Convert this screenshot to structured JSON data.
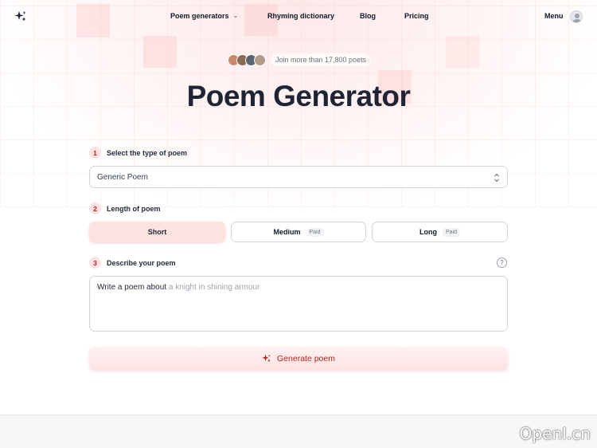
{
  "header": {
    "logo_icon": "sparkles-icon",
    "nav": [
      {
        "label": "Poem generators",
        "has_dropdown": true
      },
      {
        "label": "Rhyming dictionary"
      },
      {
        "label": "Blog"
      },
      {
        "label": "Pricing"
      }
    ],
    "menu_label": "Menu",
    "user_icon": "user-avatar-icon"
  },
  "social_proof": {
    "text": "Join more than 17,800 poets",
    "avatar_count": 4
  },
  "title": "Poem Generator",
  "steps": [
    {
      "number": "1",
      "label": "Select the type of poem"
    },
    {
      "number": "2",
      "label": "Length of poem"
    },
    {
      "number": "3",
      "label": "Describe your poem"
    }
  ],
  "poem_type": {
    "selected": "Generic Poem"
  },
  "lengths": [
    {
      "label": "Short",
      "selected": true
    },
    {
      "label": "Medium",
      "badge": "Paid"
    },
    {
      "label": "Long",
      "badge": "Paid"
    }
  ],
  "description": {
    "prefix": "Write a poem about",
    "placeholder": "a knight in shining armour"
  },
  "generate_button": {
    "label": "Generate poem",
    "icon": "sparkles-icon"
  },
  "watermark": "OpenI.cn",
  "colors": {
    "accent": "#b42318",
    "accent_soft": "#fde2e2",
    "title": "#1e2433"
  }
}
